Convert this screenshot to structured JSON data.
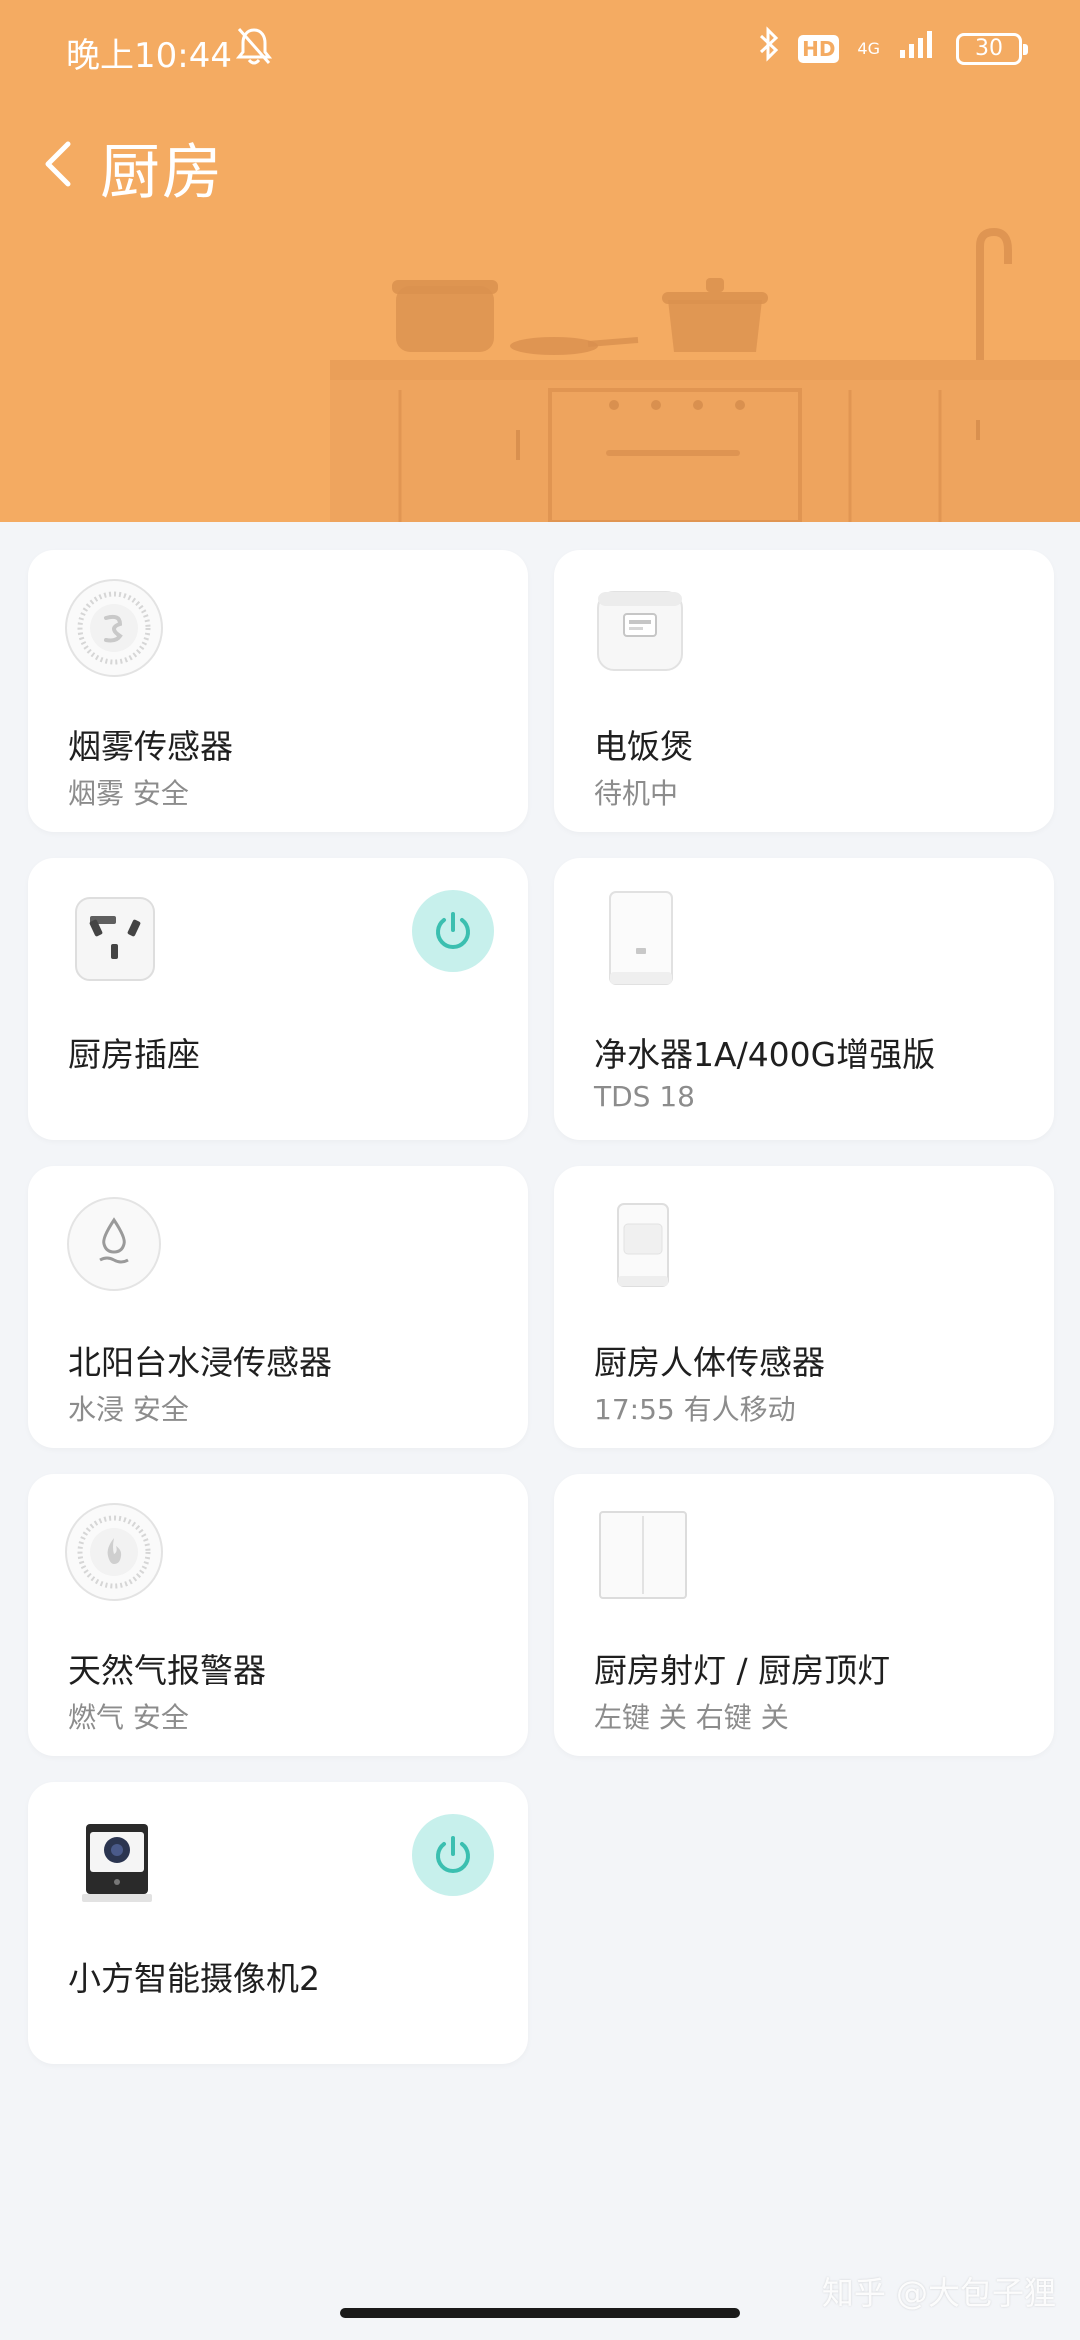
{
  "status_bar": {
    "time": "晚上10:44",
    "hd": "HD",
    "network": "4G",
    "battery": "30"
  },
  "header": {
    "title": "厨房"
  },
  "devices": [
    {
      "name": "烟雾传感器",
      "status": "烟雾 安全",
      "icon": "smoke-sensor-icon"
    },
    {
      "name": "电饭煲",
      "status": "待机中",
      "icon": "rice-cooker-icon"
    },
    {
      "name": "厨房插座",
      "status": "",
      "icon": "smart-plug-icon",
      "power": true
    },
    {
      "name": "净水器1A/400G增强版",
      "status": "TDS 18",
      "icon": "water-purifier-icon"
    },
    {
      "name": "北阳台水浸传感器",
      "status": "水浸 安全",
      "icon": "water-sensor-icon"
    },
    {
      "name": "厨房人体传感器",
      "status": "17:55 有人移动",
      "icon": "motion-sensor-icon"
    },
    {
      "name": "天然气报警器",
      "status": "燃气 安全",
      "icon": "gas-alarm-icon"
    },
    {
      "name": "厨房射灯 / 厨房顶灯",
      "status": "左键 关 右键 关",
      "icon": "wall-switch-icon"
    },
    {
      "name": "小方智能摄像机2",
      "status": "",
      "icon": "camera-icon",
      "power": true
    }
  ],
  "watermark": "知乎 @大包子狸",
  "colors": {
    "header_bg": "#f4ab62",
    "page_bg": "#f3f5f8",
    "power_on_bg": "#c7f0ec",
    "power_on_fg": "#3bbfb0"
  }
}
